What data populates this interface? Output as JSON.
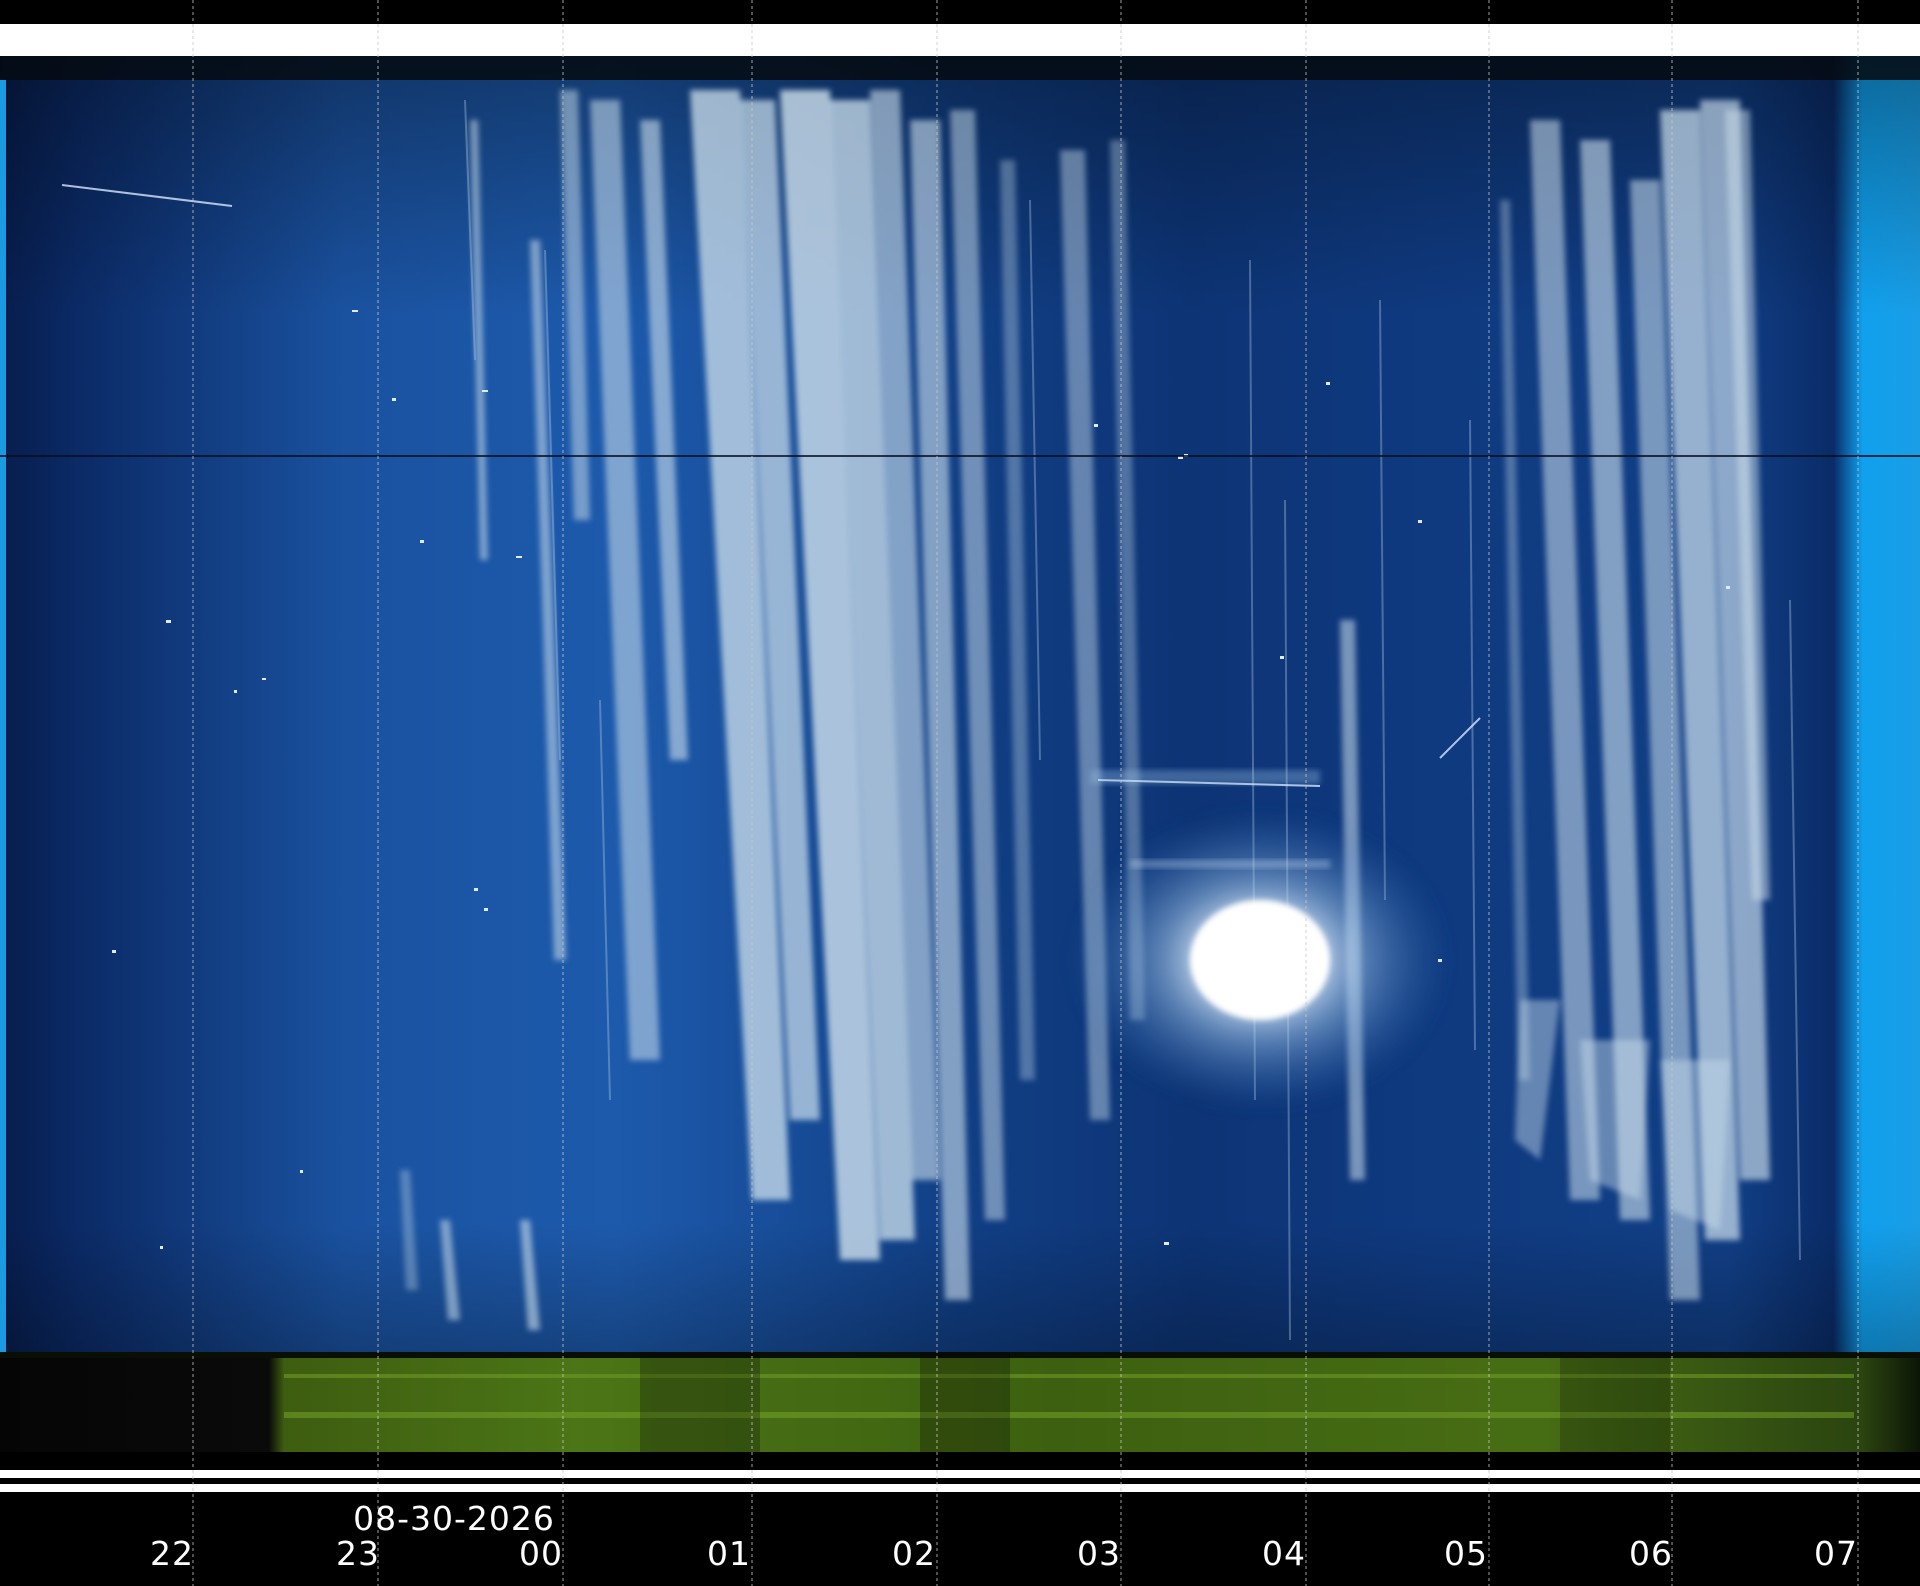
{
  "keogram": {
    "date_label": "08-30-2026",
    "hour_labels": [
      "22",
      "23",
      "00",
      "01",
      "02",
      "03",
      "04",
      "05",
      "06",
      "07"
    ]
  },
  "colors": {
    "sky_dark": "#082a6a",
    "sky_mid": "#1a57a5",
    "cloud": "#c9dcea",
    "ground": "#4d7a12",
    "twilight": "#16a2ee",
    "grid": "#bfbfbf",
    "text": "#ffffff"
  }
}
